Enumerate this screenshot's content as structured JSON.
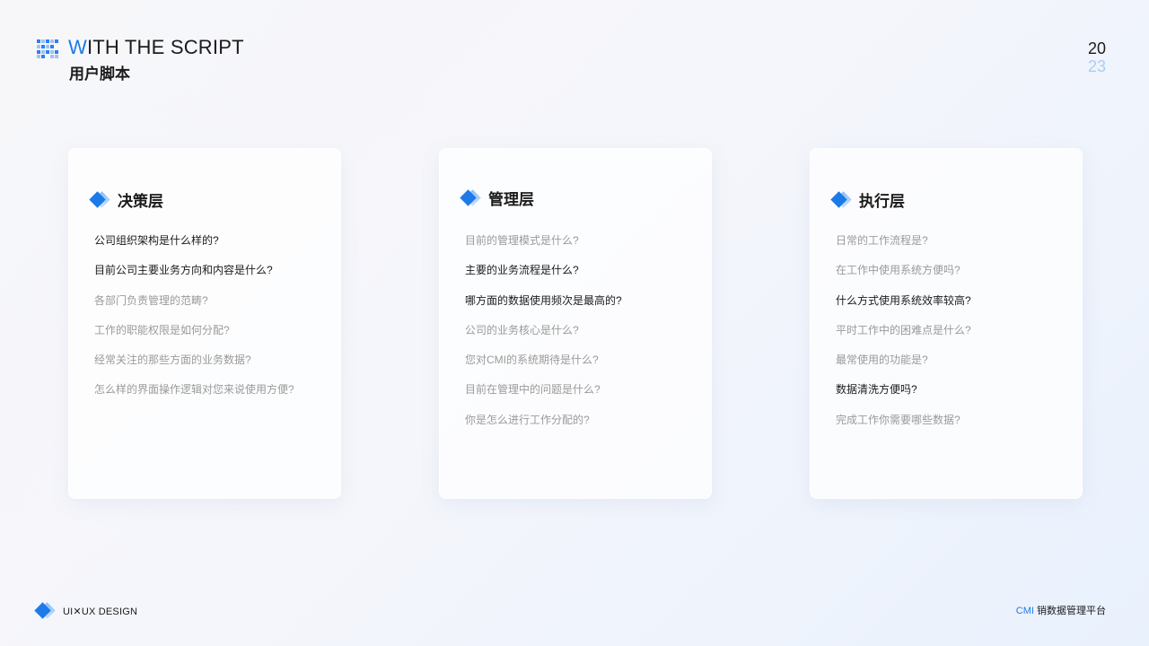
{
  "header": {
    "title_en_first": "W",
    "title_en_rest": "ITH THE SCRIPT",
    "title_cn": "用户脚本",
    "year_top": "20",
    "year_bottom": "23"
  },
  "columns": [
    {
      "title": "决策层",
      "questions": [
        {
          "text": "公司组织架构是什么样的?",
          "highlight": true
        },
        {
          "text": "目前公司主要业务方向和内容是什么?",
          "highlight": true
        },
        {
          "text": "各部门负责管理的范畴?",
          "highlight": false
        },
        {
          "text": "工作的职能权限是如何分配?",
          "highlight": false
        },
        {
          "text": "经常关注的那些方面的业务数据?",
          "highlight": false
        },
        {
          "text": "怎么样的界面操作逻辑对您来说使用方便?",
          "highlight": false
        }
      ]
    },
    {
      "title": "管理层",
      "questions": [
        {
          "text": "目前的管理模式是什么?",
          "highlight": false
        },
        {
          "text": "主要的业务流程是什么?",
          "highlight": true
        },
        {
          "text": "哪方面的数据使用频次是最高的?",
          "highlight": true
        },
        {
          "text": "公司的业务核心是什么?",
          "highlight": false
        },
        {
          "text": "您对CMI的系统期待是什么?",
          "highlight": false
        },
        {
          "text": "目前在管理中的问题是什么?",
          "highlight": false
        },
        {
          "text": "你是怎么进行工作分配的?",
          "highlight": false
        }
      ]
    },
    {
      "title": "执行层",
      "questions": [
        {
          "text": "日常的工作流程是?",
          "highlight": false
        },
        {
          "text": "在工作中使用系统方便吗?",
          "highlight": false
        },
        {
          "text": "什么方式使用系统效率较高?",
          "highlight": true
        },
        {
          "text": "平时工作中的困难点是什么?",
          "highlight": false
        },
        {
          "text": "最常使用的功能是?",
          "highlight": false
        },
        {
          "text": "数据清洗方便吗?",
          "highlight": true
        },
        {
          "text": "完成工作你需要哪些数据?",
          "highlight": false
        }
      ]
    }
  ],
  "footer": {
    "left_label": "UI✕UX DESIGN",
    "right_accent": "CMI",
    "right_label": " 销数据管理平台"
  },
  "colors": {
    "accent": "#1c7be8",
    "accent_light": "#a9cdf5",
    "text_primary": "#1b1b1b",
    "text_muted": "#9a9a9a"
  }
}
